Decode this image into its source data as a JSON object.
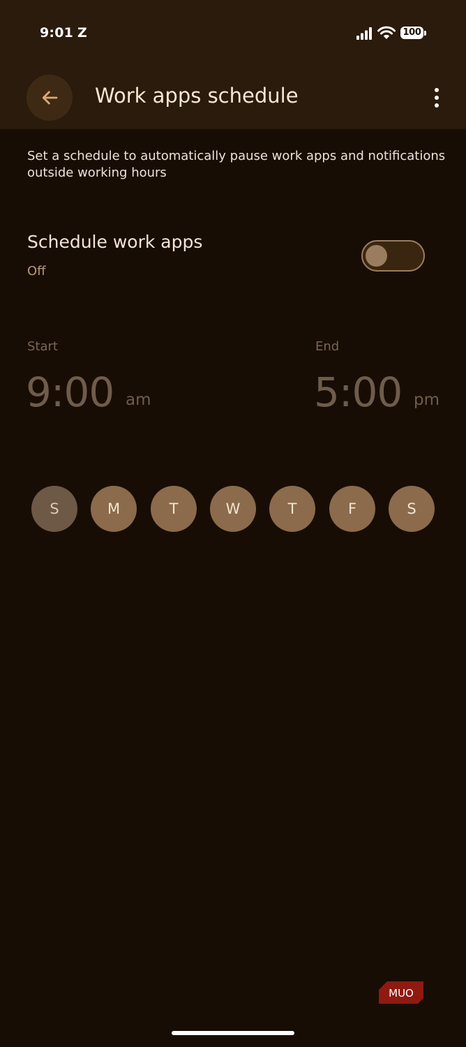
{
  "status_bar": {
    "time": "9:01",
    "notification_letter": "Z",
    "battery_level": "100"
  },
  "header": {
    "title": "Work apps schedule"
  },
  "description": "Set a schedule to automatically pause work apps and notifications outside working hours",
  "schedule_setting": {
    "title": "Schedule work apps",
    "status": "Off",
    "enabled": false
  },
  "start": {
    "label": "Start",
    "time": "9:00",
    "period": "am"
  },
  "end": {
    "label": "End",
    "time": "5:00",
    "period": "pm"
  },
  "days": [
    {
      "label": "S",
      "active": false
    },
    {
      "label": "M",
      "active": true
    },
    {
      "label": "T",
      "active": true
    },
    {
      "label": "W",
      "active": true
    },
    {
      "label": "T",
      "active": true
    },
    {
      "label": "F",
      "active": true
    },
    {
      "label": "S",
      "active": true
    }
  ],
  "watermark": {
    "text": "MUO",
    "color": "#8e1a10"
  },
  "colors": {
    "background": "#180d05",
    "header_background": "#2a1b0c",
    "accent": "#8b6b4b",
    "toggle_track": "#3a2610"
  },
  "icons": {
    "back": "arrow-back-icon",
    "more": "more-vert-icon",
    "signal": "signal-icon",
    "wifi": "wifi-icon",
    "battery": "battery-icon"
  }
}
